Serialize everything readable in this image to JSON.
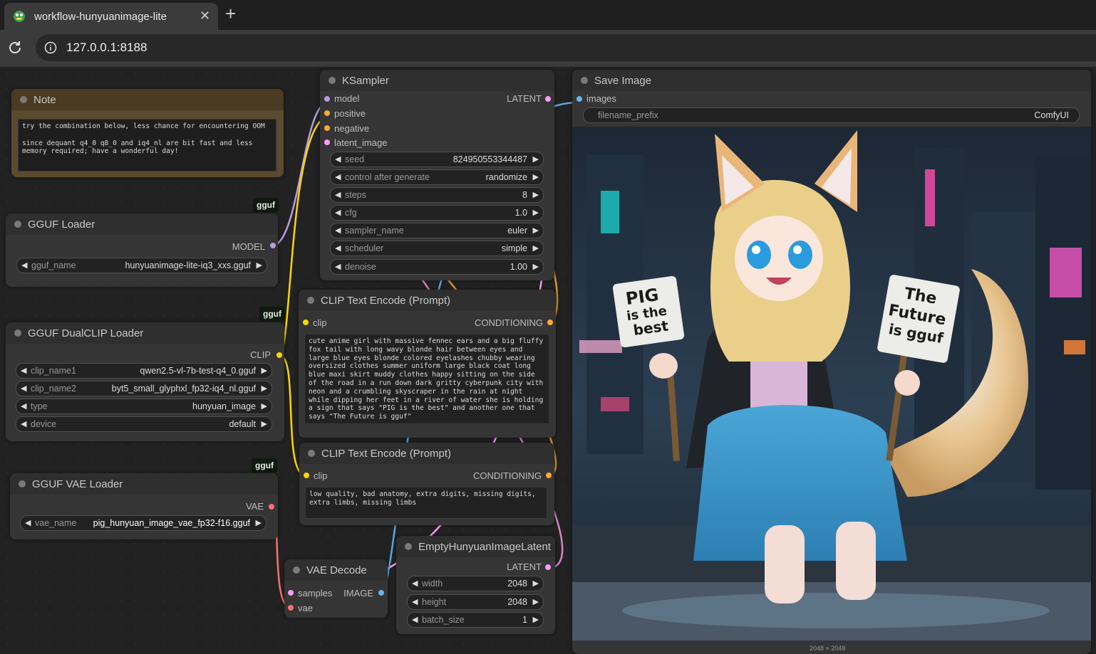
{
  "browser": {
    "tab_title": "workflow-hunyuanimage-lite",
    "tab_close": "✕",
    "new_tab": "+",
    "url": "127.0.0.1:8188"
  },
  "nodes": {
    "note": {
      "title": "Note",
      "text": "try the combination below, less chance for encountering OOM\n\nsince dequant q4_0 q8_0 and iq4_nl are bit fast and less memory required; have a wonderful day!"
    },
    "gguf_loader": {
      "badge": "gguf",
      "title": "GGUF Loader",
      "output": "MODEL",
      "widget": {
        "name": "gguf_name",
        "value": "hunyuanimage-lite-iq3_xxs.gguf"
      }
    },
    "dualclip": {
      "badge": "gguf",
      "title": "GGUF DualCLIP Loader",
      "output": "CLIP",
      "widgets": [
        {
          "name": "clip_name1",
          "value": "qwen2.5-vl-7b-test-q4_0.gguf"
        },
        {
          "name": "clip_name2",
          "value": "byt5_small_glyphxl_fp32-iq4_nl.gguf"
        },
        {
          "name": "type",
          "value": "hunyuan_image"
        },
        {
          "name": "device",
          "value": "default"
        }
      ]
    },
    "vae_loader": {
      "badge": "gguf",
      "title": "GGUF VAE Loader",
      "output": "VAE",
      "widget": {
        "name": "vae_name",
        "value": "pig_hunyuan_image_vae_fp32-f16.gguf"
      }
    },
    "ksampler": {
      "title": "KSampler",
      "inputs": [
        "model",
        "positive",
        "negative",
        "latent_image"
      ],
      "output": "LATENT",
      "widgets": [
        {
          "name": "seed",
          "value": "824950553344487"
        },
        {
          "name": "control after generate",
          "value": "randomize"
        },
        {
          "name": "steps",
          "value": "8"
        },
        {
          "name": "cfg",
          "value": "1.0"
        },
        {
          "name": "sampler_name",
          "value": "euler"
        },
        {
          "name": "scheduler",
          "value": "simple"
        },
        {
          "name": "denoise",
          "value": "1.00"
        }
      ]
    },
    "clip_pos": {
      "title": "CLIP Text Encode (Prompt)",
      "input": "clip",
      "output": "CONDITIONING",
      "text": "cute anime girl with massive fennec ears and a big fluffy fox tail with long wavy blonde hair between eyes and large blue eyes blonde colored eyelashes chubby wearing oversized clothes summer uniform large black coat long blue maxi skirt muddy clothes happy sitting on the side of the road in a run down dark gritty cyberpunk city with neon and a crumbling skyscraper in the rain at night while dipping her feet in a river of water she is holding a sign that says \"PIG is the best\" and another one that says \"The Future is gguf\""
    },
    "clip_neg": {
      "title": "CLIP Text Encode (Prompt)",
      "input": "clip",
      "output": "CONDITIONING",
      "text": "low quality, bad anatomy, extra digits, missing digits, extra limbs, missing limbs"
    },
    "empty_latent": {
      "title": "EmptyHunyuanImageLatent",
      "output": "LATENT",
      "widgets": [
        {
          "name": "width",
          "value": "2048"
        },
        {
          "name": "height",
          "value": "2048"
        },
        {
          "name": "batch_size",
          "value": "1"
        }
      ]
    },
    "vae_decode": {
      "title": "VAE Decode",
      "inputs": [
        "samples",
        "vae"
      ],
      "output": "IMAGE"
    },
    "save_image": {
      "title": "Save Image",
      "input": "images",
      "widget": {
        "name": "filename_prefix",
        "value": "ComfyUI"
      },
      "sign1": [
        "PIG",
        "is the",
        "best"
      ],
      "sign2": [
        "The",
        "Future",
        "is gguf"
      ],
      "caption": "2048 × 2048"
    }
  },
  "colors": {
    "model": "#b39ddb",
    "clip": "#ffd500",
    "conditioning": "#ffa931",
    "latent": "#ff9cf9",
    "vae": "#ff6e6e",
    "image": "#64b5f6"
  }
}
